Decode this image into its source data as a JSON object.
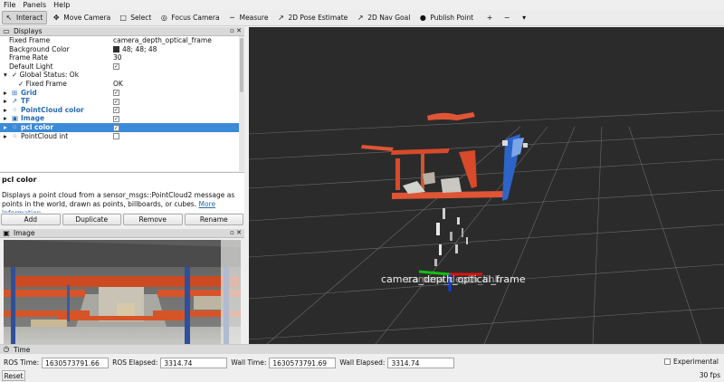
{
  "menu": [
    "File",
    "Panels",
    "Help"
  ],
  "toolbar": [
    {
      "label": "Interact",
      "icon": "interact-icon",
      "glyph": "↖",
      "active": true
    },
    {
      "label": "Move Camera",
      "icon": "move-camera-icon",
      "glyph": "✥",
      "active": false
    },
    {
      "label": "Select",
      "icon": "select-icon",
      "glyph": "□",
      "active": false
    },
    {
      "label": "Focus Camera",
      "icon": "focus-camera-icon",
      "glyph": "◎",
      "active": false
    },
    {
      "label": "Measure",
      "icon": "measure-icon",
      "glyph": "─",
      "active": false
    },
    {
      "label": "2D Pose Estimate",
      "icon": "pose-estimate-icon",
      "glyph": "↗",
      "active": false
    },
    {
      "label": "2D Nav Goal",
      "icon": "nav-goal-icon",
      "glyph": "↗",
      "active": false
    },
    {
      "label": "Publish Point",
      "icon": "publish-point-icon",
      "glyph": "●",
      "active": false
    }
  ],
  "toolbar_extra_icons": [
    {
      "icon": "add-tool-icon",
      "glyph": "+"
    },
    {
      "icon": "remove-tool-icon",
      "glyph": "−"
    },
    {
      "icon": "tool-settings-icon",
      "glyph": "▾"
    }
  ],
  "displays": {
    "title": "Displays",
    "rows": [
      {
        "key": "Fixed Frame",
        "value": "camera_depth_optical_frame",
        "indent": 10
      },
      {
        "key": "Background Color",
        "value": "48; 48; 48",
        "indent": 10,
        "swatch": true
      },
      {
        "key": "Frame Rate",
        "value": "30",
        "indent": 10
      },
      {
        "key": "Default Light",
        "value": "✓",
        "indent": 10,
        "check": true
      },
      {
        "key": "✓ Global Status: Ok",
        "value": "",
        "indent": 4,
        "arrow": "▾"
      },
      {
        "key": "✓ Fixed Frame",
        "value": "OK",
        "indent": 20
      },
      {
        "key": "Grid",
        "value": "✓",
        "indent": 4,
        "arrow": "▸",
        "blue": true,
        "check": true,
        "icon": "grid-icon",
        "glyph": "⊞"
      },
      {
        "key": "TF",
        "value": "✓",
        "indent": 4,
        "arrow": "▸",
        "blue": true,
        "check": true,
        "icon": "tf-icon",
        "glyph": "↗"
      },
      {
        "key": "PointCloud color",
        "value": "✓",
        "indent": 4,
        "arrow": "▸",
        "blue": true,
        "check": true,
        "icon": "pointcloud-icon",
        "glyph": "⁘"
      },
      {
        "key": "Image",
        "value": "✓",
        "indent": 4,
        "arrow": "▸",
        "blue": true,
        "check": true,
        "icon": "image-icon",
        "glyph": "▣"
      },
      {
        "key": "pcl color",
        "value": "✓",
        "indent": 4,
        "arrow": "▸",
        "selected": true,
        "check": true,
        "icon": "pointcloud-icon",
        "glyph": "⁘"
      },
      {
        "key": "PointCloud int",
        "value": "",
        "indent": 4,
        "arrow": "▸",
        "check": true,
        "icon": "pointcloud-icon",
        "glyph": "⁘"
      }
    ],
    "description_title": "pcl color",
    "description_text": "Displays a point cloud from a sensor_msgs::PointCloud2 message as points in the world, drawn as points, billboards, or cubes.",
    "description_more": "More Information"
  },
  "buttons": {
    "add": "Add",
    "duplicate": "Duplicate",
    "remove": "Remove",
    "rename": "Rename"
  },
  "image_panel": {
    "title": "Image"
  },
  "viewport": {
    "frame_label": "camera_depth_optical_frame",
    "frame_label_overlap": "camera_depth_link"
  },
  "time": {
    "title": "Time",
    "ros_time_label": "ROS Time:",
    "ros_time": "1630573791.66",
    "ros_elapsed_label": "ROS Elapsed:",
    "ros_elapsed": "3314.74",
    "wall_time_label": "Wall Time:",
    "wall_time": "1630573791.69",
    "wall_elapsed_label": "Wall Elapsed:",
    "wall_elapsed": "3314.74",
    "experimental_label": "Experimental",
    "reset_label": "Reset",
    "fps": "30 fps"
  },
  "colors": {
    "accent": "#3b8ad8",
    "background": "#303030",
    "shelf": "#e0502a",
    "axis_x": "#e01010",
    "axis_y": "#10c010",
    "axis_z": "#1040e0"
  }
}
